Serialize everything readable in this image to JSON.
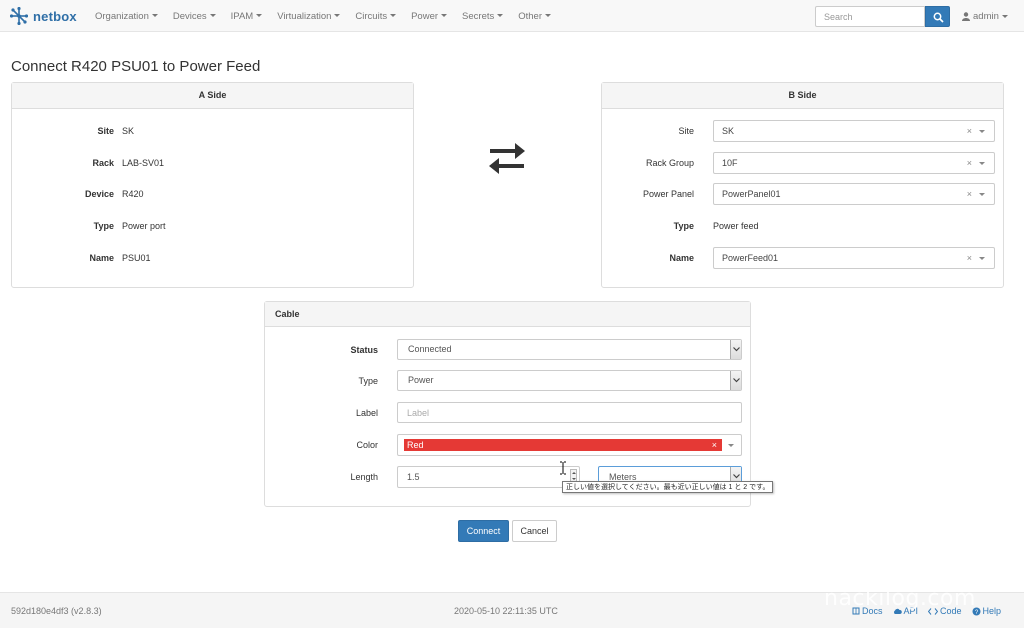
{
  "navbar": {
    "brand": "netbox",
    "menu": [
      {
        "label": "Organization"
      },
      {
        "label": "Devices"
      },
      {
        "label": "IPAM"
      },
      {
        "label": "Virtualization"
      },
      {
        "label": "Circuits"
      },
      {
        "label": "Power"
      },
      {
        "label": "Secrets"
      },
      {
        "label": "Other"
      }
    ],
    "search_placeholder": "Search",
    "user": "admin"
  },
  "page": {
    "title": "Connect R420 PSU01 to Power Feed"
  },
  "a_side": {
    "heading": "A Side",
    "fields": [
      {
        "label": "Site",
        "value": "SK"
      },
      {
        "label": "Rack",
        "value": "LAB-SV01"
      },
      {
        "label": "Device",
        "value": "R420"
      },
      {
        "label": "Type",
        "value": "Power port"
      },
      {
        "label": "Name",
        "value": "PSU01"
      }
    ]
  },
  "b_side": {
    "heading": "B Side",
    "site": {
      "label": "Site",
      "value": "SK"
    },
    "rack_group": {
      "label": "Rack Group",
      "value": "10F"
    },
    "power_panel": {
      "label": "Power Panel",
      "value": "PowerPanel01"
    },
    "type": {
      "label": "Type",
      "value": "Power feed"
    },
    "name": {
      "label": "Name",
      "value": "PowerFeed01"
    },
    "clear_glyph": "×"
  },
  "cable": {
    "heading": "Cable",
    "status": {
      "label": "Status",
      "value": "Connected"
    },
    "type": {
      "label": "Type",
      "value": "Power"
    },
    "label": {
      "label": "Label",
      "placeholder": "Label",
      "value": ""
    },
    "color": {
      "label": "Color",
      "value": "Red",
      "swatch": "#e53935"
    },
    "length": {
      "label": "Length",
      "value": "1.5",
      "unit": "Meters"
    },
    "tooltip": "正しい値を選択してください。最も近い正しい値は 1 と 2 です。"
  },
  "buttons": {
    "connect": "Connect",
    "cancel": "Cancel"
  },
  "footer": {
    "version": "592d180e4df3 (v2.8.3)",
    "timestamp": "2020-05-10 22:11:35 UTC",
    "links": [
      {
        "label": "Docs",
        "icon": "book-icon"
      },
      {
        "label": "API",
        "icon": "cloud-icon"
      },
      {
        "label": "Code",
        "icon": "code-icon"
      },
      {
        "label": "Help",
        "icon": "help-icon"
      }
    ],
    "watermark": "nackilog.com"
  },
  "colors": {
    "accent": "#337ab7",
    "brand": "#2f6fa7",
    "cable_red": "#e53935"
  }
}
